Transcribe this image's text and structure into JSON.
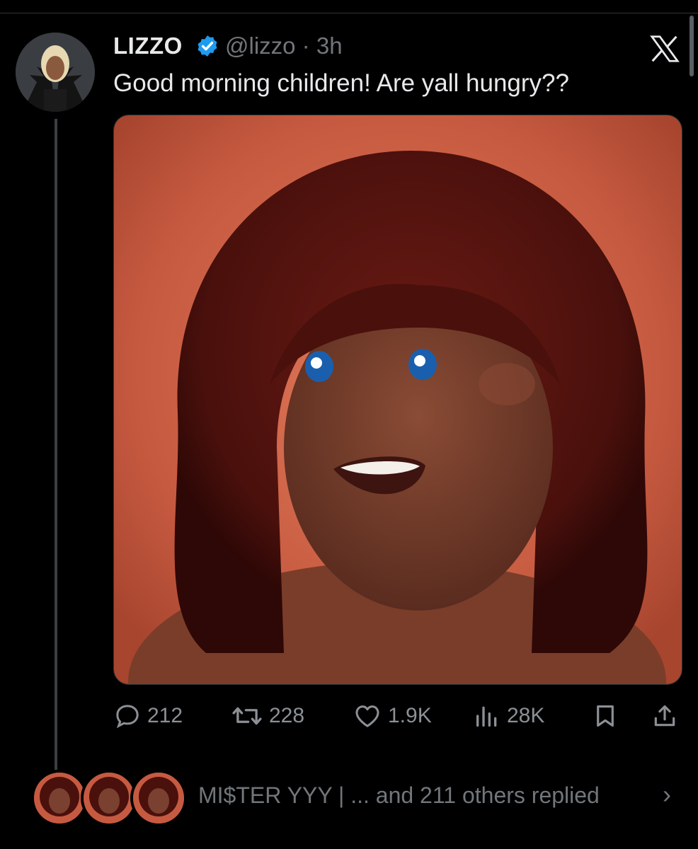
{
  "tweet": {
    "author_name": "LIZZO",
    "handle_and_time": "@lizzo · 3h",
    "text": "Good morning children! Are yall hungry??",
    "verified": true
  },
  "actions": {
    "replies": "212",
    "retweets": "228",
    "likes": "1.9K",
    "views": "28K"
  },
  "replies_summary": {
    "text": "MI$TER YYY | ... and 211 others replied",
    "chevron": "›"
  },
  "icons": [
    "x-logo-icon",
    "verified-badge-icon",
    "reply-icon",
    "retweet-icon",
    "like-icon",
    "views-icon",
    "bookmark-icon",
    "share-icon",
    "chevron-right-icon"
  ],
  "colors": {
    "background": "#000000",
    "text": "#e7e9ea",
    "muted": "#71767b",
    "verified": "#1d9bf0",
    "media_bg": "#c8573f"
  }
}
